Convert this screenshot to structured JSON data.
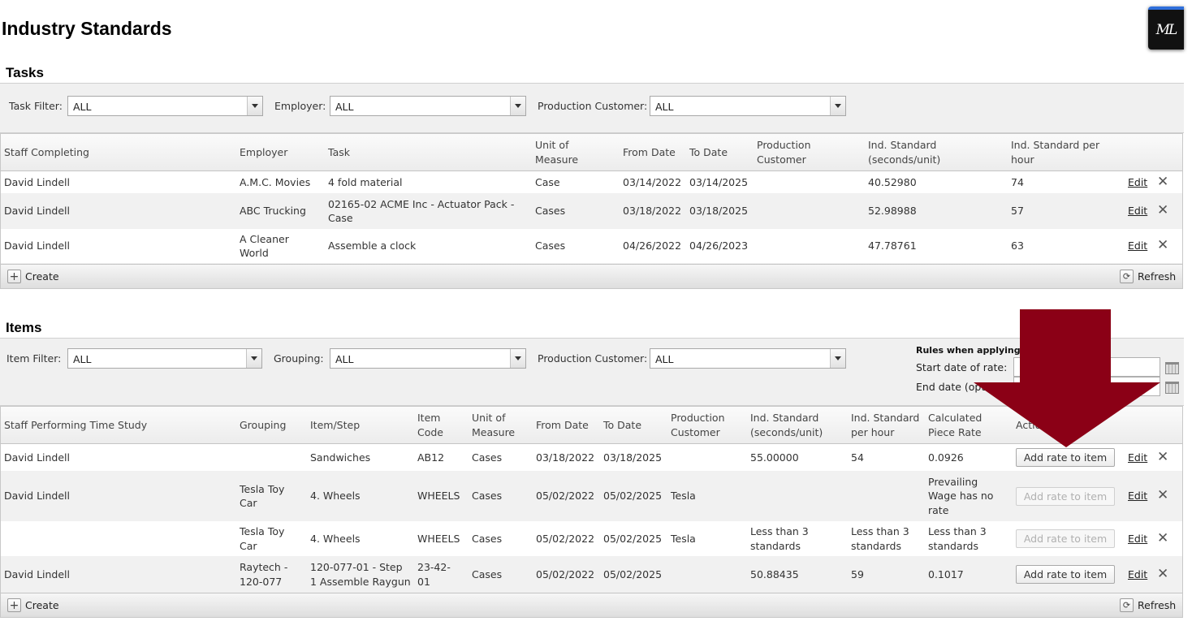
{
  "page": {
    "title": "Industry Standards",
    "logo_text": "ML"
  },
  "tasks": {
    "section_title": "Tasks",
    "filters": [
      {
        "label": "Task Filter:",
        "value": "ALL"
      },
      {
        "label": "Employer:",
        "value": "ALL"
      },
      {
        "label": "Production Customer:",
        "value": "ALL"
      }
    ],
    "columns": [
      "Staff Completing",
      "Employer",
      "Task",
      "Unit of Measure",
      "From Date",
      "To Date",
      "Production Customer",
      "Ind. Standard (seconds/unit)",
      "Ind. Standard per hour"
    ],
    "rows": [
      {
        "staff": "David Lindell",
        "employer": "A.M.C. Movies",
        "task": "4 fold material",
        "unit": "Case",
        "from": "03/14/2022",
        "to": "03/14/2025",
        "customer": "",
        "std_sec": "40.52980",
        "std_hr": "74"
      },
      {
        "staff": "David Lindell",
        "employer": "ABC Trucking",
        "task": "02165-02 ACME Inc - Actuator Pack - Case",
        "unit": "Cases",
        "from": "03/18/2022",
        "to": "03/18/2025",
        "customer": "",
        "std_sec": "52.98988",
        "std_hr": "57"
      },
      {
        "staff": "David Lindell",
        "employer": "A Cleaner World",
        "task": "Assemble a clock",
        "unit": "Cases",
        "from": "04/26/2022",
        "to": "04/26/2023",
        "customer": "",
        "std_sec": "47.78761",
        "std_hr": "63"
      }
    ],
    "edit_label": "Edit",
    "delete_glyph": "✕",
    "create_label": "Create",
    "refresh_label": "Refresh"
  },
  "items": {
    "section_title": "Items",
    "filters": [
      {
        "label": "Item Filter:",
        "value": "ALL"
      },
      {
        "label": "Grouping:",
        "value": "ALL"
      },
      {
        "label": "Production Customer:",
        "value": "ALL"
      }
    ],
    "rules": {
      "title": "Rules when applying ra",
      "start_label": "Start date of rate:",
      "end_label": "End date (optio"
    },
    "columns": [
      "Staff Performing Time Study",
      "Grouping",
      "Item/Step",
      "Item Code",
      "Unit of Measure",
      "From Date",
      "To Date",
      "Production Customer",
      "Ind. Standard (seconds/unit)",
      "Ind. Standard per hour",
      "Calculated Piece Rate",
      "Actio"
    ],
    "rows": [
      {
        "staff": "David Lindell",
        "grouping": "",
        "item": "Sandwiches",
        "code": "AB12",
        "unit": "Cases",
        "from": "03/18/2022",
        "to": "03/18/2025",
        "customer": "",
        "std_sec": "55.00000",
        "std_hr": "54",
        "rate": "0.0926",
        "btn_enabled": true
      },
      {
        "staff": "David Lindell",
        "grouping": "Tesla Toy Car",
        "item": "4. Wheels",
        "code": "WHEELS",
        "unit": "Cases",
        "from": "05/02/2022",
        "to": "05/02/2025",
        "customer": "Tesla",
        "std_sec": "",
        "std_hr": "",
        "rate": "Prevailing Wage has no rate",
        "btn_enabled": false
      },
      {
        "staff": "",
        "grouping": "Tesla Toy Car",
        "item": "4. Wheels",
        "code": "WHEELS",
        "unit": "Cases",
        "from": "05/02/2022",
        "to": "05/02/2025",
        "customer": "Tesla",
        "std_sec": "Less than 3 standards",
        "std_hr": "Less than 3 standards",
        "rate": "Less than 3 standards",
        "btn_enabled": false
      },
      {
        "staff": "David Lindell",
        "grouping": "Raytech - 120-077",
        "item": "120-077-01 - Step 1 Assemble Raygun",
        "code": "23-42-01",
        "unit": "Cases",
        "from": "05/02/2022",
        "to": "05/02/2025",
        "customer": "",
        "std_sec": "50.88435",
        "std_hr": "59",
        "rate": "0.1017",
        "btn_enabled": true
      }
    ],
    "add_rate_label": "Add rate to item",
    "edit_label": "Edit",
    "delete_glyph": "✕",
    "create_label": "Create",
    "refresh_label": "Refresh"
  },
  "colors": {
    "arrow": "#8b0016",
    "logo_accent": "#2f6fdb"
  }
}
